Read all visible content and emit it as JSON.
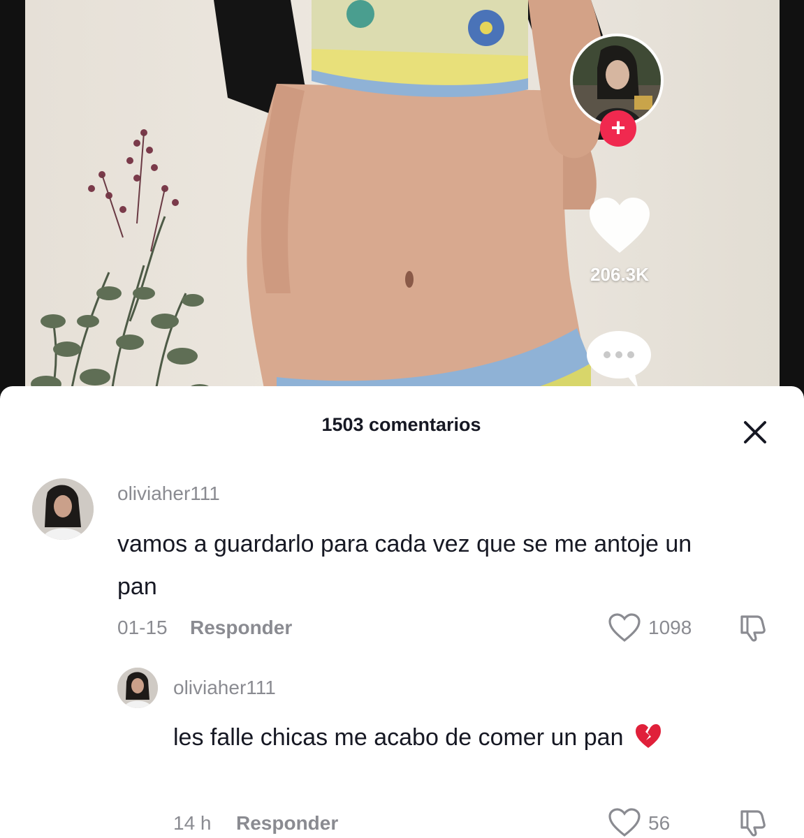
{
  "video": {
    "like_count": "206.3K",
    "accent_color": "#f0294f"
  },
  "comments_panel": {
    "title": "1503 comentarios",
    "close_icon": "close-icon",
    "comments": [
      {
        "username": "oliviaher111",
        "text": "vamos a guardarlo para cada vez que se me antoje un pan",
        "time": "01-15",
        "reply_label": "Responder",
        "likes": "1098"
      },
      {
        "username": "oliviaher111",
        "text": "les falle chicas me acabo de comer un pan",
        "emoji": "broken-heart-icon",
        "time": "14 h",
        "reply_label": "Responder",
        "likes": "56"
      }
    ]
  }
}
